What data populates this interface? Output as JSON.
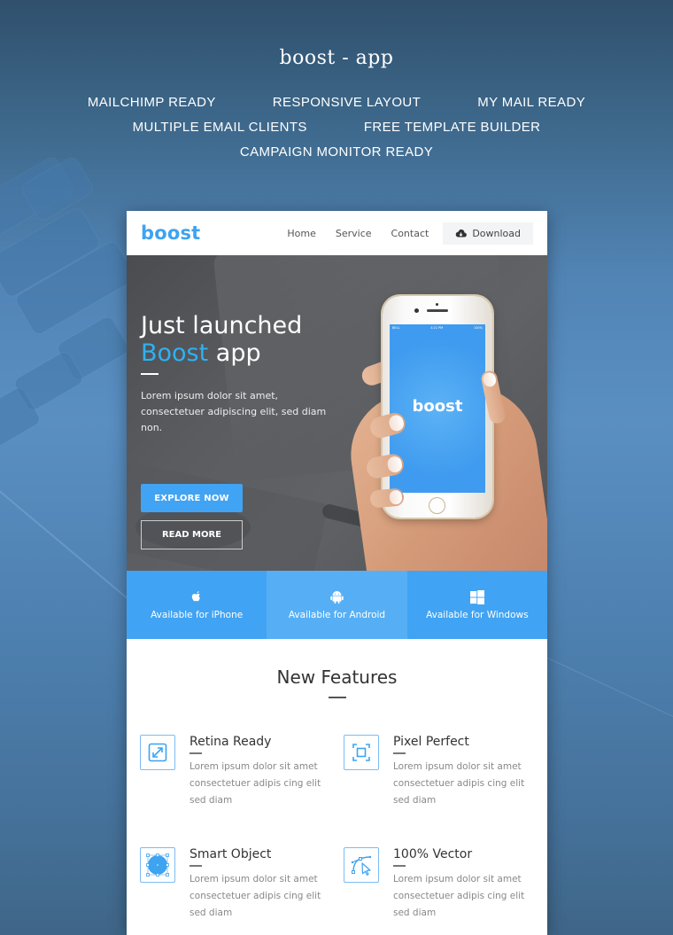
{
  "showcase": {
    "title": "boost - app",
    "tags_row1": [
      "MAILCHIMP READY",
      "RESPONSIVE LAYOUT",
      "MY MAIL READY"
    ],
    "tags_row2": [
      "MULTIPLE EMAIL CLIENTS",
      "FREE TEMPLATE BUILDER"
    ],
    "tags_row3": [
      "CAMPAIGN MONITOR READY"
    ]
  },
  "nav": {
    "logo": "boost",
    "links": [
      "Home",
      "Service",
      "Contact"
    ],
    "download_label": "Download",
    "download_icon": "cloud-download-icon"
  },
  "hero": {
    "title_line1": "Just launched",
    "title_accent": "Boost",
    "title_rest": " app",
    "description": "Lorem ipsum dolor sit amet, consectetuer adipiscing elit, sed diam non.",
    "primary_button": "EXPLORE NOW",
    "secondary_button": "READ MORE",
    "phone": {
      "app_name": "boost",
      "carrier": "BELL",
      "time": "4:21 PM",
      "battery": "100%"
    }
  },
  "platforms": [
    {
      "label": "Available for iPhone",
      "icon": "apple-icon"
    },
    {
      "label": "Available for Android",
      "icon": "android-icon"
    },
    {
      "label": "Available for Windows",
      "icon": "windows-icon"
    }
  ],
  "features": {
    "title": "New Features",
    "items": [
      {
        "title": "Retina Ready",
        "description": "Lorem ipsum dolor sit amet consectetuer adipis cing elit sed diam",
        "icon": "expand-arrows-icon"
      },
      {
        "title": "Pixel Perfect",
        "description": "Lorem ipsum dolor sit amet consectetuer adipis cing elit sed diam",
        "icon": "focus-frame-icon"
      },
      {
        "title": "Smart Object",
        "description": "Lorem ipsum dolor sit amet consectetuer adipis cing elit sed diam",
        "icon": "smart-object-circle-icon"
      },
      {
        "title": "100% Vector",
        "description": "Lorem ipsum dolor sit amet consectetuer adipis cing elit sed diam",
        "icon": "vector-pen-icon"
      }
    ]
  },
  "colors": {
    "brand_blue": "#41a3f3",
    "accent_cyan": "#2fb1f2",
    "platform_active": "#56aff5",
    "icon_border": "#7bbcf3"
  }
}
